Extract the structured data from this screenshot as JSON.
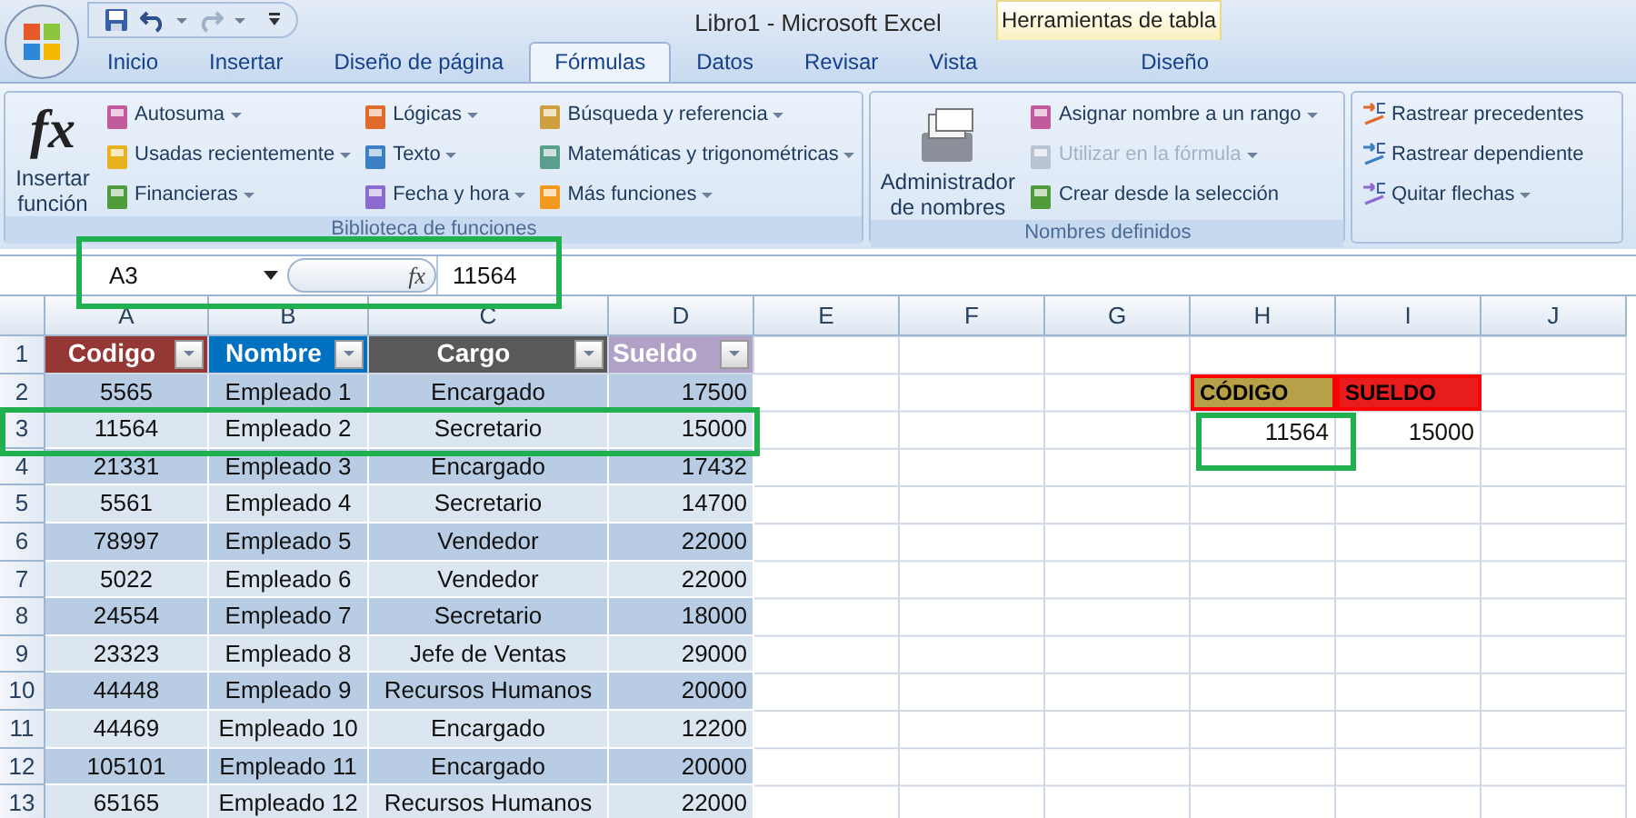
{
  "window": {
    "title": "Libro1 - Microsoft Excel",
    "context_label": "Herramientas de tabla"
  },
  "tabs": [
    {
      "label": "Inicio",
      "selected": false
    },
    {
      "label": "Insertar",
      "selected": false
    },
    {
      "label": "Diseño de página",
      "selected": false
    },
    {
      "label": "Fórmulas",
      "selected": true
    },
    {
      "label": "Datos",
      "selected": false
    },
    {
      "label": "Revisar",
      "selected": false
    },
    {
      "label": "Vista",
      "selected": false
    },
    {
      "label": "Diseño",
      "selected": false,
      "kind": "contextual"
    }
  ],
  "ribbon": {
    "groups": [
      {
        "label": "Biblioteca de funciones",
        "big": {
          "symbol": "fx",
          "label": "Insertar función"
        },
        "columns": [
          [
            {
              "label": "Autosuma",
              "dropdown": true,
              "disabled": false
            },
            {
              "label": "Usadas recientemente",
              "dropdown": true,
              "disabled": false
            },
            {
              "label": "Financieras",
              "dropdown": true,
              "disabled": false
            }
          ],
          [
            {
              "label": "Lógicas",
              "dropdown": true,
              "disabled": false
            },
            {
              "label": "Texto",
              "dropdown": true,
              "disabled": false
            },
            {
              "label": "Fecha y hora",
              "dropdown": true,
              "disabled": false
            }
          ],
          [
            {
              "label": "Búsqueda y referencia",
              "dropdown": true,
              "disabled": false
            },
            {
              "label": "Matemáticas y trigonométricas",
              "dropdown": true,
              "disabled": false
            },
            {
              "label": "Más funciones",
              "dropdown": true,
              "disabled": false
            }
          ]
        ]
      },
      {
        "label": "Nombres definidos",
        "big": {
          "label": "Administrador de nombres"
        },
        "columns": [
          [
            {
              "label": "Asignar nombre a un rango",
              "dropdown": true,
              "disabled": false
            },
            {
              "label": "Utilizar en la fórmula",
              "dropdown": true,
              "disabled": true
            },
            {
              "label": "Crear desde la selección",
              "dropdown": false,
              "disabled": false
            }
          ]
        ]
      },
      {
        "columns": [
          [
            {
              "label": "Rastrear precedentes",
              "dropdown": false,
              "disabled": false
            },
            {
              "label": "Rastrear dependiente",
              "dropdown": false,
              "disabled": false
            },
            {
              "label": "Quitar flechas",
              "dropdown": true,
              "disabled": false
            }
          ]
        ]
      }
    ]
  },
  "formula_bar": {
    "name_box": "A3",
    "fx": "fx",
    "value": "11564",
    "highlighted": true
  },
  "sheet": {
    "columns": [
      "A",
      "B",
      "C",
      "D",
      "E",
      "F",
      "G",
      "H",
      "I",
      "J"
    ],
    "row_numbers": [
      "1",
      "2",
      "3",
      "4",
      "5",
      "6",
      "7",
      "8",
      "9",
      "10",
      "11",
      "12",
      "13"
    ],
    "table": {
      "headers": [
        {
          "label": "Codigo",
          "color": "#953735"
        },
        {
          "label": "Nombre",
          "color": "#0070c0"
        },
        {
          "label": "Cargo",
          "color": "#595959"
        },
        {
          "label": "Sueldo",
          "color": "#b2a1c7"
        }
      ],
      "rows": [
        {
          "cells": [
            "5565",
            "Empleado 1",
            "Encargado",
            "17500"
          ],
          "highlighted": false
        },
        {
          "cells": [
            "11564",
            "Empleado 2",
            "Secretario",
            "15000"
          ],
          "highlighted": true
        },
        {
          "cells": [
            "21331",
            "Empleado 3",
            "Encargado",
            "17432"
          ],
          "highlighted": false
        },
        {
          "cells": [
            "5561",
            "Empleado 4",
            "Secretario",
            "14700"
          ],
          "highlighted": false
        },
        {
          "cells": [
            "78997",
            "Empleado 5",
            "Vendedor",
            "22000"
          ],
          "highlighted": false
        },
        {
          "cells": [
            "5022",
            "Empleado 6",
            "Vendedor",
            "22000"
          ],
          "highlighted": false
        },
        {
          "cells": [
            "24554",
            "Empleado 7",
            "Secretario",
            "18000"
          ],
          "highlighted": false
        },
        {
          "cells": [
            "23323",
            "Empleado 8",
            "Jefe de Ventas",
            "29000"
          ],
          "highlighted": false
        },
        {
          "cells": [
            "44448",
            "Empleado 9",
            "Recursos Humanos",
            "20000"
          ],
          "highlighted": false
        },
        {
          "cells": [
            "44469",
            "Empleado 10",
            "Encargado",
            "12200"
          ],
          "highlighted": false
        },
        {
          "cells": [
            "105101",
            "Empleado 11",
            "Encargado",
            "20000"
          ],
          "highlighted": false
        },
        {
          "cells": [
            "65165",
            "Empleado 12",
            "Recursos Humanos",
            "22000"
          ],
          "highlighted": false
        }
      ]
    },
    "lookup": {
      "headers": [
        {
          "label": "CÓDIGO",
          "color": "#b8a048"
        },
        {
          "label": "SUELDO",
          "color": "#e81c1c"
        }
      ],
      "values": [
        {
          "text": "11564",
          "highlighted": true
        },
        {
          "text": "15000",
          "highlighted": false
        }
      ]
    }
  }
}
